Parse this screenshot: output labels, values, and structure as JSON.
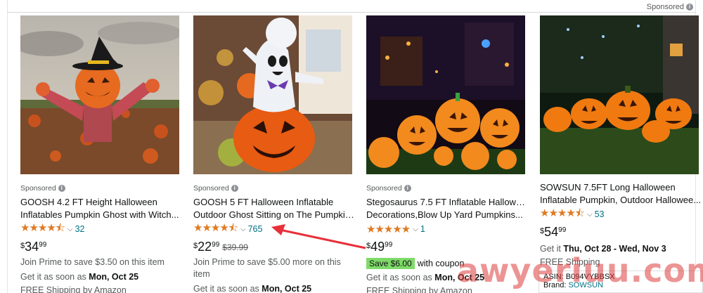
{
  "sponsored_top": "Sponsored",
  "products": [
    {
      "sponsored": "Sponsored",
      "title": "GOOSH 4.2 FT Height Halloween Inflatables Pumpkin Ghost with Witch...",
      "title_line1": "GOOSH 4.2 FT Height Halloween",
      "title_line2": "Inflatables Pumpkin Ghost with Witch...",
      "stars": "★★★★⯪",
      "rating_count": "32",
      "price_currency": "$",
      "price_whole": "34",
      "price_fraction": "99",
      "list_price": "",
      "line1": "Join Prime to save $3.50 on this item",
      "line2_prefix": "Get it as soon as ",
      "line2_date": "Mon, Oct 25",
      "line3": "FREE Shipping by Amazon"
    },
    {
      "sponsored": "Sponsored",
      "title_line1": "GOOSH 5 FT Halloween Inflatable",
      "title_line2": "Outdoor Ghost Sitting on The Pumpkin...",
      "stars": "★★★★⯪",
      "rating_count": "765",
      "price_currency": "$",
      "price_whole": "22",
      "price_fraction": "99",
      "list_price": "$39.99",
      "line1": "Join Prime to save $5.00 more on this",
      "line1b": "item",
      "line2_prefix": "Get it as soon as ",
      "line2_date": "Mon, Oct 25"
    },
    {
      "sponsored": "Sponsored",
      "title_line1": "Stegosaurus 7.5 FT Inflatable Halloween",
      "title_line2": "Decorations,Blow Up Yard Pumpkins...",
      "stars": "★★★★★",
      "rating_count": "1",
      "price_currency": "$",
      "price_whole": "49",
      "price_fraction": "99",
      "save_badge": "Save $6.00",
      "coupon_text": "with coupon",
      "line2_prefix": "Get it as soon as ",
      "line2_date": "Mon, Oct 25",
      "line3": "FREE Shipping by Amazon"
    },
    {
      "title_line1": "SOWSUN 7.5FT Long Halloween",
      "title_line2": "Inflatable Pumpkin, Outdoor Hallowee...",
      "stars": "★★★★⯪",
      "rating_count": "53",
      "price_currency": "$",
      "price_whole": "54",
      "price_fraction": "99",
      "line2_prefix": "Get it ",
      "line2_date": "Thu, Oct 28 - Wed, Nov 3",
      "line3": "FREE Shipping",
      "asin_label": "ASIN: B094VYBBSX",
      "brand_label": "Brand: ",
      "brand_value": "SOWSUN"
    }
  ],
  "watermark": "awyeriuu.com",
  "colors": {
    "star": "#de7921",
    "link": "#007185",
    "save": "#7fda69",
    "arrow": "#e8303a"
  }
}
